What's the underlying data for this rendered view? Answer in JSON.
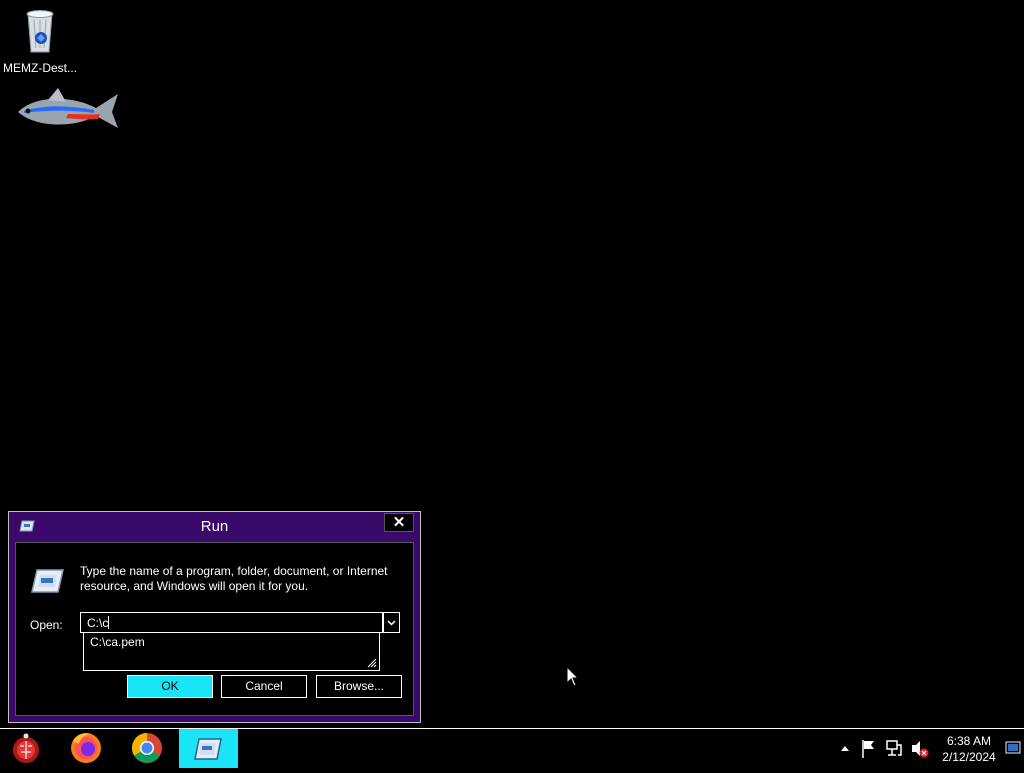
{
  "desktop": {
    "icons": [
      {
        "label": "MEMZ-Dest...",
        "icon": "recycle-bin-icon"
      },
      {
        "label": "",
        "icon": "fish-icon"
      }
    ]
  },
  "run_dialog": {
    "title": "Run",
    "close_label": "✕",
    "description": "Type the name of a program, folder, document, or Internet resource, and Windows will open it for you.",
    "open_label": "Open:",
    "open_value": "C:\\c",
    "suggestion": "C:\\ca.pem",
    "ok_label": "OK",
    "cancel_label": "Cancel",
    "browse_label": "Browse..."
  },
  "taskbar": {
    "apps": [
      {
        "name": "start-orb"
      },
      {
        "name": "firefox"
      },
      {
        "name": "chrome"
      },
      {
        "name": "run",
        "active": true
      }
    ],
    "tray_icons": [
      "show-hidden-icons",
      "action-center-flag",
      "network",
      "volume-muted",
      "show-desktop"
    ],
    "clock_time": "6:38 AM",
    "clock_date": "2/12/2024"
  },
  "colors": {
    "accent_cyan": "#1ae4f8",
    "dialog_frame": "#3a0a6a",
    "background": "#000000"
  }
}
